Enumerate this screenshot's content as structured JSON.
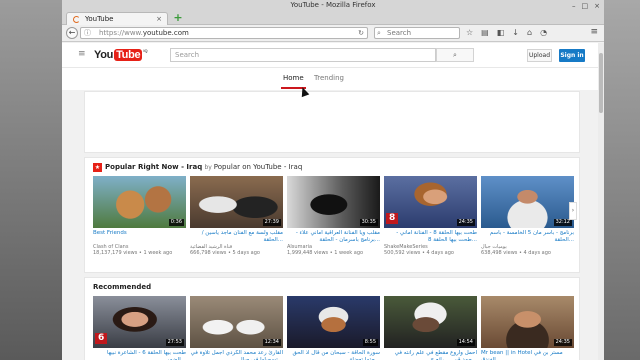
{
  "window": {
    "title": "YouTube - Mozilla Firefox"
  },
  "tab": {
    "label": "YouTube"
  },
  "nav": {
    "url_prefix": "https://www.",
    "url_domain": "youtube.com",
    "search_placeholder": "Search"
  },
  "yt": {
    "search_placeholder": "Search",
    "upload": "Upload",
    "signin": "Sign in",
    "tabs": [
      "Home",
      "Trending"
    ]
  },
  "shelf1": {
    "title": "Popular Right Now - Iraq",
    "by": "by",
    "by_channel": "Popular on YouTube - Iraq",
    "videos": [
      {
        "title": "Best Friends",
        "channel": "Clash of Clans",
        "meta": "18,137,179 views • 1 week ago",
        "duration": "0:36",
        "rtl": false
      },
      {
        "title": "مقلب ولسة مع الفنان ماجد ياسين / الحلقة...",
        "channel": "قناة الرشيد الفضائية",
        "meta": "666,798 views • 5 days ago",
        "duration": "27:39",
        "rtl": true
      },
      {
        "title": "مقلب ويا الفنانة العراقية اماني علاء - برنامج باسرمان - الحلقة...",
        "channel": "Alsumaria",
        "meta": "1,999,448 views • 1 week ago",
        "duration": "30:35",
        "rtl": true
      },
      {
        "title": "طحت بيها الحلقة 8 - الفنانة اماني - طحت بيها الحلقة 8...",
        "channel": "ShakeMakeSeries",
        "meta": "500,592 views • 4 days ago",
        "duration": "24:35",
        "rtl": true
      },
      {
        "title": "برنامج - باسر مان 5 الخامسة - باسم الحلقة...",
        "channel": "يوميات جبال",
        "meta": "638,498 views • 4 days ago",
        "duration": "32:12",
        "rtl": true
      }
    ]
  },
  "shelf2": {
    "title": "Recommended",
    "videos": [
      {
        "title": "طحت بيها الحلقة 6 - الشاعرة نبيها الضمر...",
        "duration": "27:53",
        "rtl": true
      },
      {
        "title": "القارئ رعد محمد الكردي اجمل تلاوة في تسجيلها في جبال...",
        "duration": "12:34",
        "rtl": true
      },
      {
        "title": "سورة الحاقة - سبحان من قال اذ الحق حتما تعضلة...",
        "duration": "8:55",
        "rtl": true
      },
      {
        "title": "احمل واروع مقطع في علم رانته في حمد قبر ... رائع ج...",
        "duration": "14:54",
        "rtl": true
      },
      {
        "title": "Mr bean || in Hotel مستر بن في الفندق",
        "duration": "24:35",
        "rtl": false
      }
    ]
  }
}
